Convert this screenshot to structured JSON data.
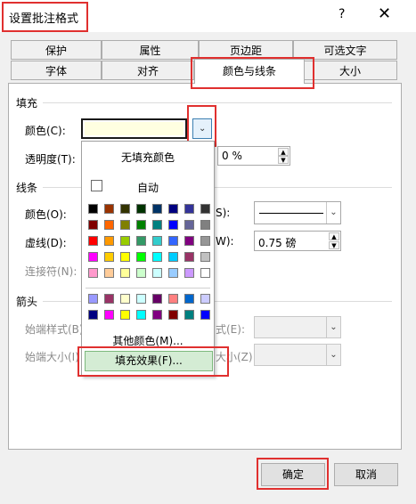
{
  "window": {
    "title": "设置批注格式",
    "help": "?",
    "close": "✕"
  },
  "tabs_top": [
    "保护",
    "属性",
    "页边距",
    "可选文字"
  ],
  "tabs_bottom": [
    "字体",
    "对齐",
    "颜色与线条",
    "大小"
  ],
  "fill": {
    "section": "填充",
    "color_label": "颜色(C):",
    "color_value": "#FFFFE1",
    "transparency_label": "透明度(T):",
    "transparency_value": "0 %"
  },
  "line": {
    "section": "线条",
    "color_label": "颜色(O):",
    "color_label_right_fragment": "S):",
    "dash_label": "虚线(D):",
    "weight_label_fragment": "W):",
    "weight_value": "0.75 磅",
    "connector_label": "连接符(N):"
  },
  "arrows": {
    "section": "箭头",
    "begin_style": "始端样式(B)",
    "begin_size": "始端大小(I)",
    "end_style_fragment": "式(E):",
    "end_size_fragment": "大小(Z):"
  },
  "popup": {
    "no_fill": "无填充颜色",
    "auto": "自动",
    "more_colors": "其他颜色(M)...",
    "fill_effects": "填充效果(F)...",
    "palette": [
      [
        "#000000",
        "#993300",
        "#333300",
        "#003300",
        "#003366",
        "#000080",
        "#333399",
        "#333333"
      ],
      [
        "#800000",
        "#FF6600",
        "#808000",
        "#008000",
        "#008080",
        "#0000FF",
        "#666699",
        "#808080"
      ],
      [
        "#FF0000",
        "#FF9900",
        "#99CC00",
        "#339966",
        "#33CCCC",
        "#3366FF",
        "#800080",
        "#969696"
      ],
      [
        "#FF00FF",
        "#FFCC00",
        "#FFFF00",
        "#00FF00",
        "#00FFFF",
        "#00CCFF",
        "#993366",
        "#C0C0C0"
      ],
      [
        "#FF99CC",
        "#FFCC99",
        "#FFFF99",
        "#CCFFCC",
        "#CCFFFF",
        "#99CCFF",
        "#CC99FF",
        "#FFFFFF"
      ]
    ],
    "palette_extra": [
      [
        "#9999FF",
        "#993366",
        "#FFFFCC",
        "#CCFFFF",
        "#660066",
        "#FF8080",
        "#0066CC",
        "#CCCCFF"
      ],
      [
        "#000080",
        "#FF00FF",
        "#FFFF00",
        "#00FFFF",
        "#800080",
        "#800000",
        "#008080",
        "#0000FF"
      ]
    ]
  },
  "buttons": {
    "ok": "确定",
    "cancel": "取消"
  },
  "highlight_color": "#E0302F"
}
